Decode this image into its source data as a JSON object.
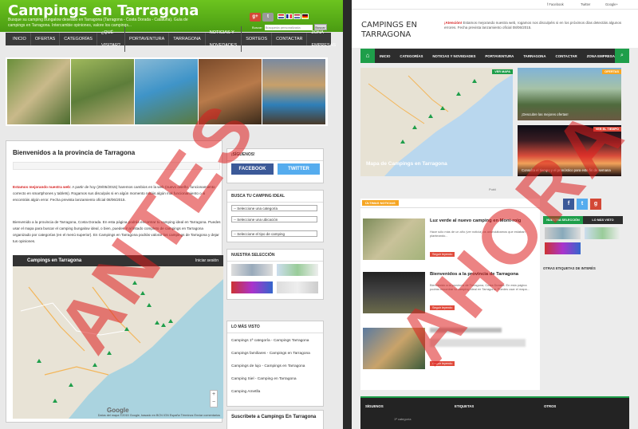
{
  "left": {
    "title": "Campings en Tarragona",
    "tagline": "Busque su camping bungalow deseado en Tarragona (Tarragona - Costa Dorada - Cataluña). Guía de campings en Tarragona. Intercambie opiniones, valore los campings...",
    "social": [
      "g+",
      "t"
    ],
    "search_label": "Buscar:",
    "search_placeholder": "Búsqueda personalizada",
    "search_button": "Buscar",
    "nav": [
      "INICIO",
      "OFERTAS",
      "CATEGORÍAS",
      "¿QUÉ VISITAR?",
      "PORTAVENTURA",
      "TARRAGONA",
      "NOTICIAS Y NOVEDADES",
      "SORTEOS",
      "CONTACTAR",
      "ZONA EMPRESAS"
    ],
    "main_title": "Bienvenidos a la provincia de Tarragona",
    "notice_strong": "Estamos mejorando nuestra web",
    "notice_text": ": A partir de hoy (29/05/2015) haremos cambios en la web (nuevo diseño, funcionamiento correcto en smartphones y tablets). Rogamos sus disculpás si en algún momento notáis algún mal funcionamiento o si encontráis algún error. Fecha prevista lanzamiento oficial 08/06/2015.",
    "welcome": "Bienvenido a la provincia de Tarragona, Costa Dorada. En esta página podrás encontrar tu camping ideal en Tarragona. Puedes usar el mapa para buscar el camping bungalow ideal, o bien, puedes ir al listado completo de campings en Tarragona organizado por categorías (en el menú superior). En Campings en Tarragona podrás valorar los campings de Tarragona y dejar tus opiniones.",
    "map_title": "Campings en Tarragona",
    "map_share": "Iniciar sesión",
    "map_brand": "Google",
    "map_legal": "Datos del mapa ©2015 Google, basado en BCN IGN España   Términos   Enviar comentarios",
    "follow_title": "¡SÍGUENOS!",
    "facebook": "FACEBOOK",
    "twitter": "TWITTER",
    "search_box_title": "BUSCA TU CAMPING IDEAL",
    "selects": [
      "-- Seleccione una categoría",
      "-- Seleccione una ubicación",
      "-- Seleccione el tipo de camping"
    ],
    "selection_title": "NUESTRA SELECCIÓN",
    "most_seen_title": "LO MÁS VISTO",
    "most_seen": [
      "Campings 1ª categoría - Campings Tarragona",
      "Campings familiares - Campings en Tarragona",
      "Campings de lujo - Campings en Tarragona",
      "Camping Siel - Camping en Tarragona",
      "Camping Ametlla"
    ],
    "subscribe_title": "Suscribete a Campings En Tarragona",
    "watermark": "ANTES"
  },
  "right": {
    "top_links": [
      "f Facebook",
      "Twitter",
      "Google+"
    ],
    "logo": "CAMPINGS EN TARRAGONA",
    "notice_strong": "¡Atención!",
    "notice_text": " Estamos mejorando nuestra web, rogamos nos disculpéis si en los próximos días detectáis algunos errores. Fecha prevista lanzamiento oficial 08/06/2015.",
    "nav": [
      "INICIO",
      "CATEGORÍAS",
      "NOTICIAS Y NOVEDADES",
      "PORTAVENTURA",
      "TARRAGONA",
      "CONTACTAR",
      "ZONA EMPRESAS"
    ],
    "map_badge": "VER MAPA",
    "map_caption": "Mapa de Campings en Tarragona",
    "offer_badge": "OFERTAS",
    "offer_caption": "¡Descubre las mejores ofertas!",
    "weather_badge": "VER EL TIEMPO",
    "weather_caption": "Consulta el tiempo y el pronóstico para este fin de semana",
    "publi": "Publi",
    "latest_badge": "ÚLTIMAS NOTICIAS",
    "articles": [
      {
        "title": "Luz verde al nuevo camping en Mont-roig",
        "desc": "Hace sólo más de un año (ver noticia) os anunciábamos que estaban planteando...",
        "more": "Seguir leyendo"
      },
      {
        "title": "Bienvenidos a la provincia de Tarragona",
        "desc": "Bienvenido a la provincia de Tarragona, Costa Dorada. En esta página podrás encontrar tu camping ideal en Tarragona. Puedes usar el mapa...",
        "more": "Seguir leyendo"
      },
      {
        "title": "",
        "desc": "",
        "more": "Seguir leyendo"
      }
    ],
    "tabs": [
      "NUESTRA SELECCIÓN",
      "LO MÁS VISTO"
    ],
    "tags_title": "OTRAS ETIQUETAS DE INTERÉS",
    "footer": [
      "SÍGUENOS",
      "ETIQUETAS",
      "OTROS"
    ],
    "footer_item": "1ª categoría",
    "watermark": "AHORA"
  }
}
